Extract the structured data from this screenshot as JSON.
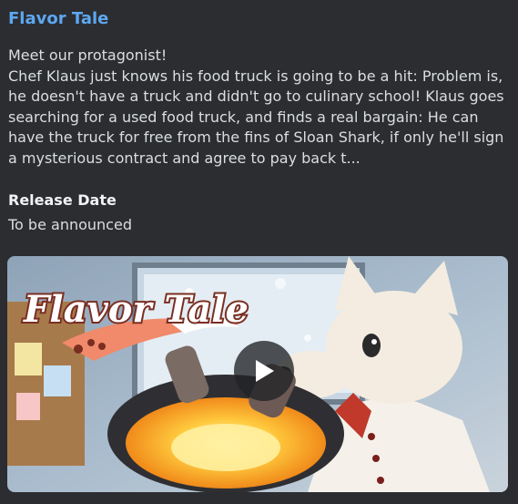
{
  "embed": {
    "title": "Flavor Tale",
    "description": "Meet our protagonist!\nChef Klaus just knows his food truck is going to be a hit: Problem is,\nhe doesn't have a truck and didn't go to culinary school! Klaus goes\nsearching for a used food truck, and finds a real bargain: He can\nhave the truck for free from the fins of Sloan Shark, if only he'll sign\na mysterious contract and agree to pay back t...",
    "field": {
      "name": "Release Date",
      "value": "To be announced"
    },
    "media": {
      "logo_text": "Flavor Tale",
      "icon": "play-icon"
    }
  },
  "colors": {
    "background": "#2b2d31",
    "title_link": "#5ea7f0",
    "text": "#dbdee1"
  }
}
